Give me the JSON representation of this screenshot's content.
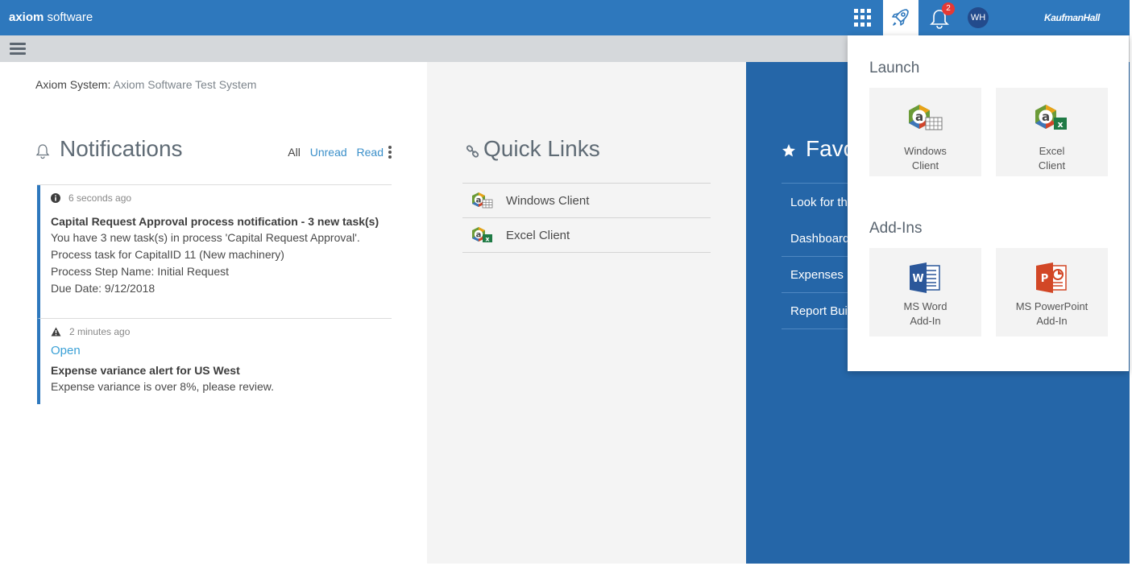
{
  "header": {
    "brand_bold": "axiom",
    "brand_rest": " software",
    "notification_count": "2",
    "user_initials": "WH",
    "company_logo": "KaufmanHall"
  },
  "system": {
    "label": "Axiom System:",
    "value": "Axiom Software Test System"
  },
  "notifications": {
    "title": "Notifications",
    "filters": {
      "all": "All",
      "unread": "Unread",
      "read": "Read"
    },
    "items": [
      {
        "icon": "info-icon",
        "time": "6 seconds ago",
        "title": "Capital Request Approval process notification - 3 new task(s)",
        "lines": [
          "You have 3 new task(s) in process 'Capital Request Approval'.",
          "Process task for CapitalID 11 (New machinery)",
          "Process Step Name: Initial Request",
          "Due Date: 9/12/2018"
        ]
      },
      {
        "icon": "warning-icon",
        "time": "2 minutes ago",
        "open_label": "Open",
        "title": "Expense variance alert for US West",
        "body": "Expense variance is over 8%, please review."
      }
    ]
  },
  "quick_links": {
    "title": "Quick Links",
    "items": [
      "Windows Client",
      "Excel Client"
    ]
  },
  "favorites": {
    "title": "Favo",
    "items": [
      "Look for th",
      "Dashboard",
      "Expenses",
      "Report Bui"
    ]
  },
  "launch_menu": {
    "launch_label": "Launch",
    "launch_tiles": [
      {
        "line1": "Windows",
        "line2": "Client"
      },
      {
        "line1": "Excel",
        "line2": "Client"
      }
    ],
    "addins_label": "Add-Ins",
    "addin_tiles": [
      {
        "line1": "MS Word",
        "line2": "Add-In"
      },
      {
        "line1": "MS PowerPoint",
        "line2": "Add-In"
      }
    ]
  },
  "colors": {
    "header_blue": "#2e78bd",
    "favorites_blue": "#2566a8",
    "link_blue": "#3a8fc9",
    "badge_red": "#e53935"
  }
}
